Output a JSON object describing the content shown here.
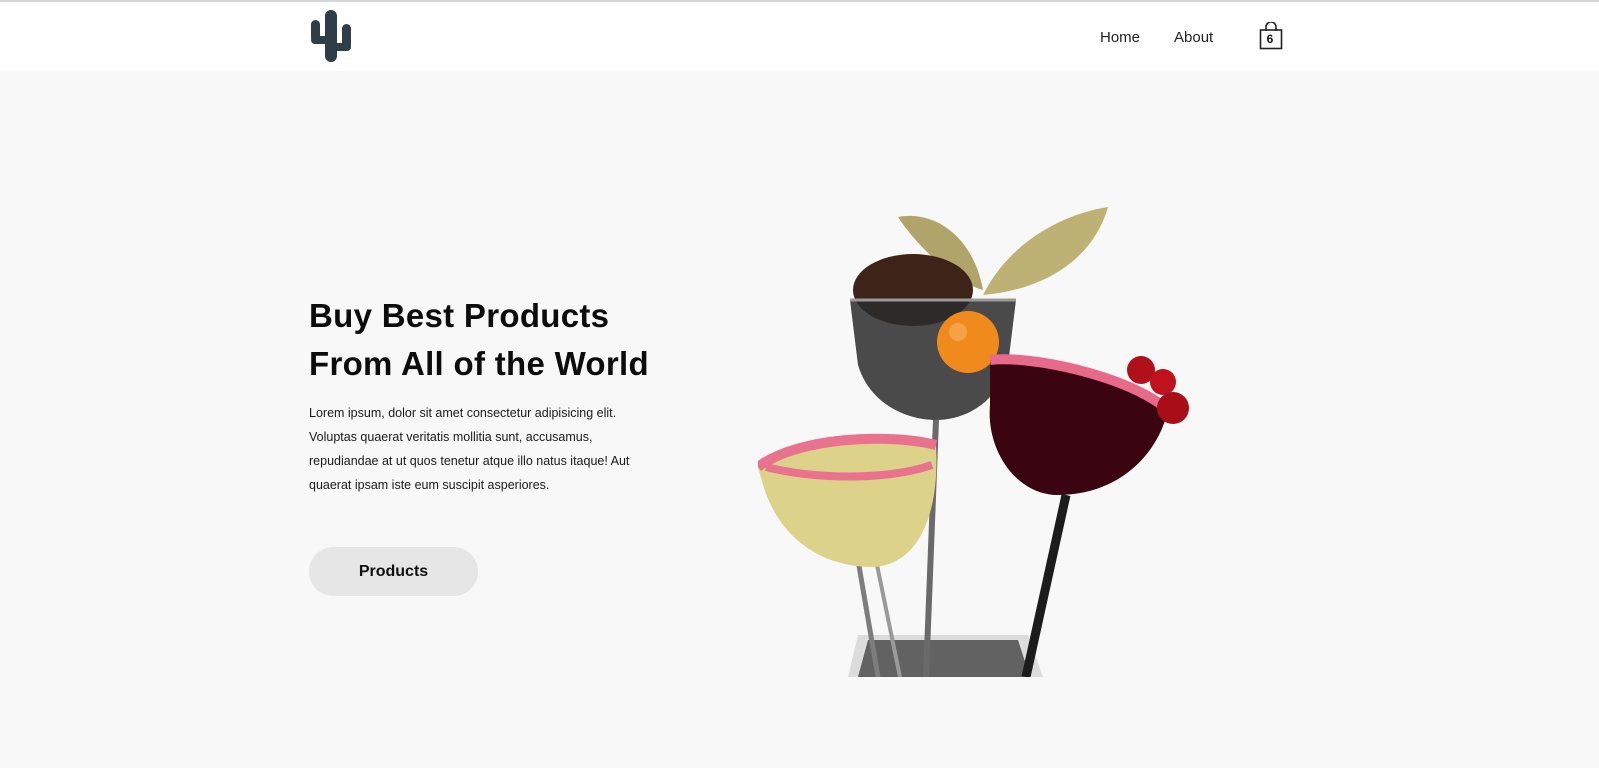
{
  "nav": {
    "logo_icon": "cactus-icon",
    "links": [
      {
        "label": "Home"
      },
      {
        "label": "About"
      }
    ],
    "cart": {
      "icon": "shopping-bag-icon",
      "count": "6"
    }
  },
  "hero": {
    "title_line1": "Buy Best Products",
    "title_line2": "From All of the World",
    "description": "Lorem ipsum, dolor sit amet consectetur adipisicing elit. Voluptas quaerat veritatis mollitia sunt, accusamus, repudiandae at ut quos tenetur atque illo natus itaque! Aut quaerat ipsam iste eum suscipit asperiores.",
    "button_label": "Products",
    "image": "cocktail-glasses-image"
  },
  "colors": {
    "background": "#f8f8f8",
    "navbar": "#ffffff",
    "logo": "#2e3d48",
    "button": "#e6e6e6"
  }
}
